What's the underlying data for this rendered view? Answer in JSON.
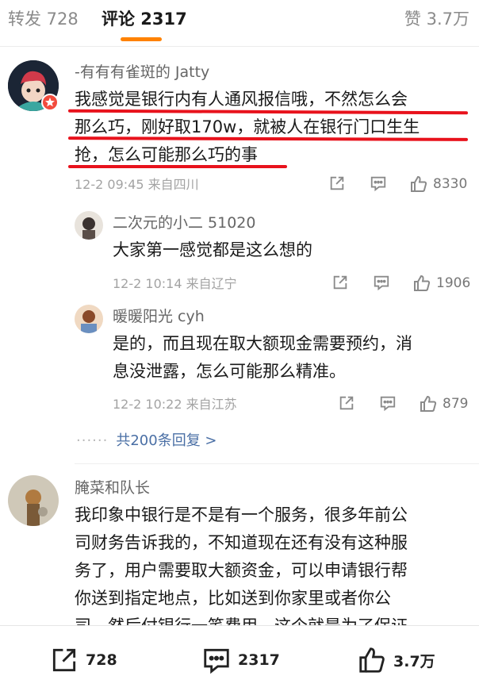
{
  "tabs": {
    "repost": "转发 728",
    "comments": "评论 2317",
    "likes": "赞 3.7万"
  },
  "comments": [
    {
      "user": "-有有有雀斑的 Jatty",
      "lines": [
        "我感觉是银行内有人通风报信哦，不然怎么会",
        "那么巧，刚好取170w，就被人在银行门口生生",
        "抢，怎么可能那么巧的事"
      ],
      "time_location": "12-2 09:45  来自四川",
      "like_count": "8330",
      "replies": [
        {
          "user": "二次元的小二 51020",
          "lines": [
            "大家第一感觉都是这么想的"
          ],
          "time_location": "12-2 10:14  来自辽宁",
          "like_count": "1906"
        },
        {
          "user": "暖暖阳光 cyh",
          "lines": [
            "是的，而且现在取大额现金需要预约，消",
            "息没泄露，怎么可能那么精准。"
          ],
          "time_location": "12-2 10:22  来自江苏",
          "like_count": "879"
        }
      ],
      "more_replies": "共200条回复 >",
      "more_dots": "······"
    },
    {
      "user": "腌菜和队长",
      "lines": [
        "我印象中银行是不是有一个服务，很多年前公",
        "司财务告诉我的，不知道现在还有没有这种服",
        "务了，用户需要取大额资金，可以申请银行帮",
        "你送到指定地点，比如送到你家里或者你公",
        "司，然后付银行一笔费用，这个就是为了保证"
      ]
    }
  ],
  "bottom_bar": {
    "repost_count": "728",
    "comment_count": "2317",
    "like_count": "3.7万"
  },
  "colors": {
    "accent": "#ff8200",
    "annotation": "#e8121c",
    "link": "#4a6fa5"
  },
  "icons": [
    "share-icon",
    "comment-icon",
    "like-icon",
    "badge-icon"
  ]
}
